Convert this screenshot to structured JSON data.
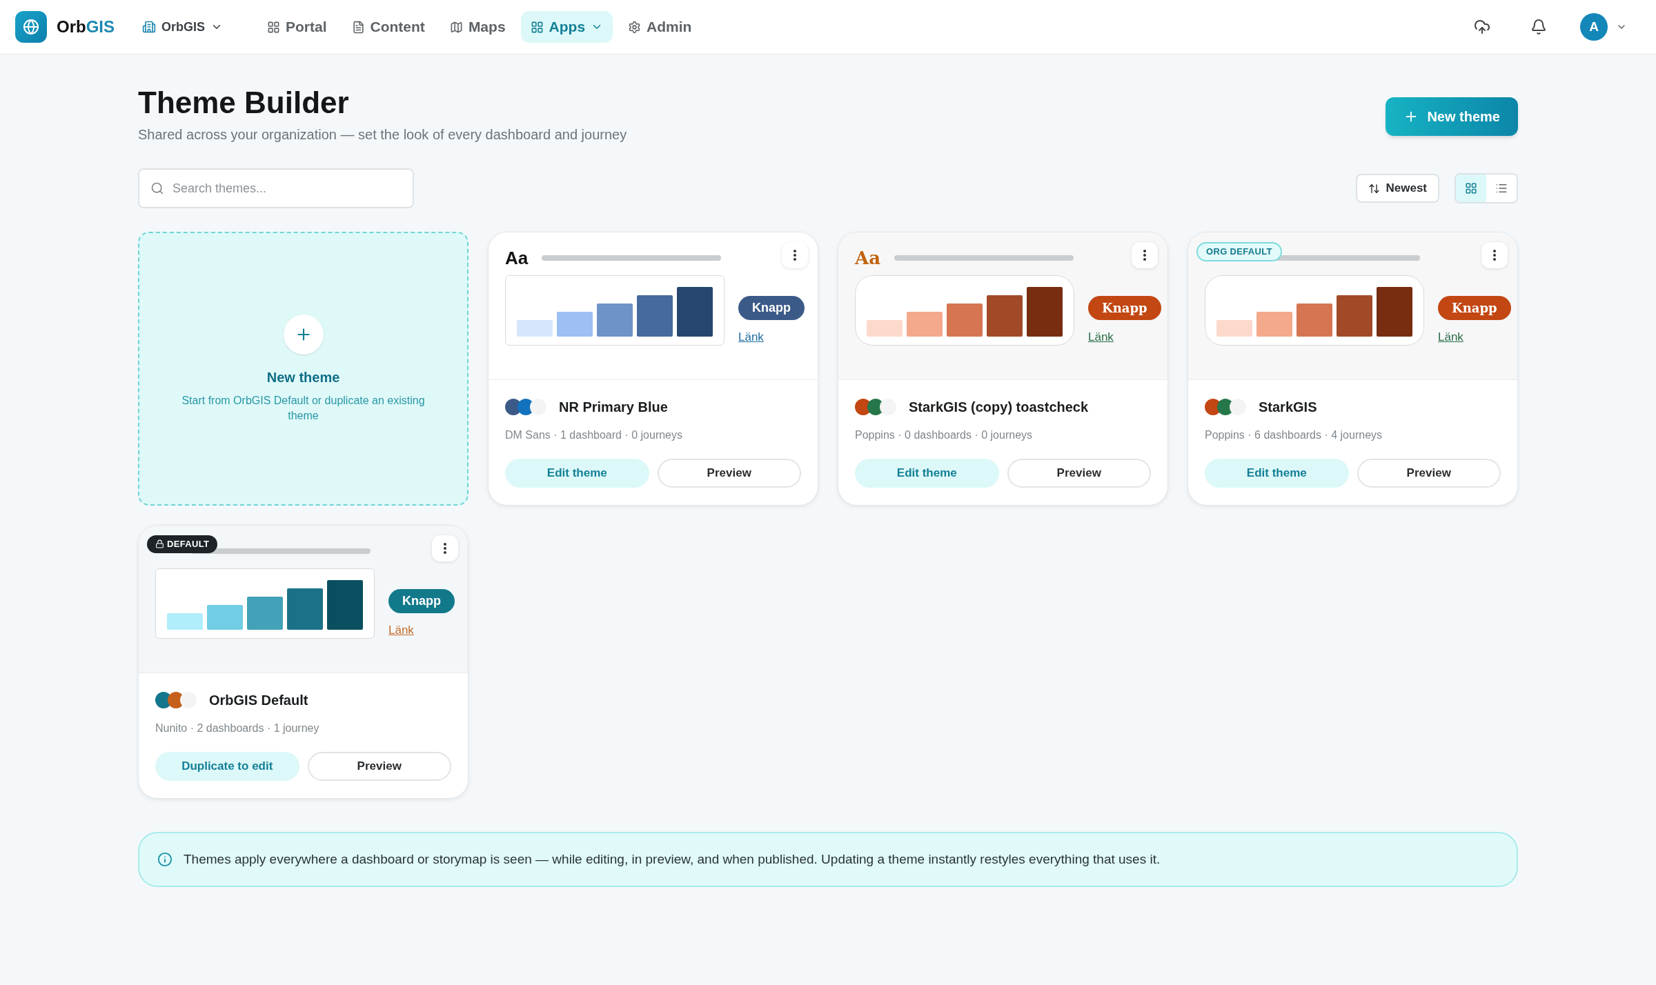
{
  "nav": {
    "brand": {
      "name": "Orb",
      "accent": "GIS"
    },
    "org": "OrbGIS",
    "items": [
      {
        "label": "Portal",
        "selected": false,
        "menu": false
      },
      {
        "label": "Content",
        "selected": false,
        "menu": false
      },
      {
        "label": "Maps",
        "selected": false,
        "menu": false
      },
      {
        "label": "Apps",
        "selected": true,
        "menu": true
      },
      {
        "label": "Admin",
        "selected": false,
        "menu": false
      }
    ],
    "avatar": "A"
  },
  "header": {
    "title": "Theme Builder",
    "subtitle": "Shared across your organization — set the look of every dashboard and journey",
    "new_button": "New theme"
  },
  "toolbar": {
    "search": {
      "placeholder": "Search themes..."
    },
    "sort": "Newest",
    "views": [
      {
        "kind": "grid",
        "selected": true
      },
      {
        "kind": "list",
        "selected": false
      }
    ]
  },
  "new_card": {
    "title": "New theme",
    "description": "Start from OrbGIS Default or duplicate an existing theme"
  },
  "themes": [
    {
      "kind": "blue",
      "name": "NR Primary Blue",
      "meta": "DM Sans · 1 dashboard · 0 journeys",
      "sample": "Aa",
      "button": "Knapp",
      "link": "Länk",
      "swatches": [
        {
          "color": "#3b5a88"
        },
        {
          "color": "#1372bd"
        },
        {
          "color": "#f4f4f4"
        }
      ],
      "actions": [
        {
          "label": "Edit theme",
          "kind": "primary"
        },
        {
          "label": "Preview",
          "kind": "outline"
        }
      ]
    },
    {
      "kind": "warm",
      "name": "StarkGIS (copy) toastcheck",
      "meta": "Poppins · 0 dashboards · 0 journeys",
      "sample": "Aa",
      "button": "Knapp",
      "link": "Länk",
      "swatches": [
        {
          "color": "#c24712"
        },
        {
          "color": "#25774a"
        },
        {
          "color": "#f4f4f4"
        }
      ],
      "actions": [
        {
          "label": "Edit theme",
          "kind": "primary"
        },
        {
          "label": "Preview",
          "kind": "outline"
        }
      ]
    },
    {
      "kind": "warm",
      "name": "StarkGIS",
      "meta": "Poppins · 6 dashboards · 4 journeys",
      "badge": {
        "kind": "org",
        "label": "ORG DEFAULT"
      },
      "button": "Knapp",
      "link": "Länk",
      "swatches": [
        {
          "color": "#c24712"
        },
        {
          "color": "#25774a"
        },
        {
          "color": "#f4f4f4"
        }
      ],
      "actions": [
        {
          "label": "Edit theme",
          "kind": "primary"
        },
        {
          "label": "Preview",
          "kind": "outline"
        }
      ]
    },
    {
      "kind": "teal",
      "name": "OrbGIS Default",
      "meta": "Nunito · 2 dashboards · 1 journey",
      "badge": {
        "kind": "locked",
        "label": "DEFAULT"
      },
      "button": "Knapp",
      "link": "Länk",
      "swatches": [
        {
          "color": "#13768a"
        },
        {
          "color": "#c4601c"
        },
        {
          "color": "#f4f4f4"
        }
      ],
      "actions": [
        {
          "label": "Duplicate to edit",
          "kind": "primary"
        },
        {
          "label": "Preview",
          "kind": "outline"
        }
      ]
    }
  ],
  "notice": "Themes apply everywhere a dashboard or storymap is seen — while editing, in preview, and when published. Updating a theme instantly restyles everything that uses it."
}
